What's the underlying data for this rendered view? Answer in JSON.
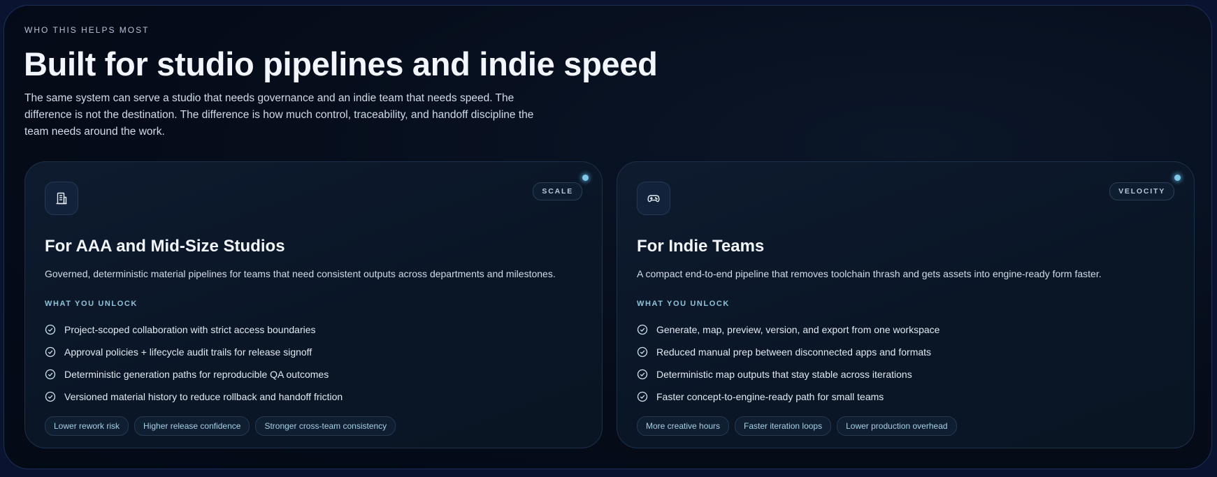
{
  "section": {
    "eyebrow": "WHO THIS HELPS MOST",
    "title": "Built for studio pipelines and indie speed",
    "subtitle": "The same system can serve a studio that needs governance and an indie team that needs speed. The difference is not the destination. The difference is how much control, traceability, and handoff discipline the team needs around the work."
  },
  "cards": [
    {
      "icon": "building-icon",
      "badge": "SCALE",
      "title": "For AAA and Mid-Size Studios",
      "description": "Governed, deterministic material pipelines for teams that need consistent outputs across departments and milestones.",
      "unlock_label": "WHAT YOU UNLOCK",
      "items": [
        "Project-scoped collaboration with strict access boundaries",
        "Approval policies + lifecycle audit trails for release signoff",
        "Deterministic generation paths for reproducible QA outcomes",
        "Versioned material history to reduce rollback and handoff friction"
      ],
      "chips": [
        "Lower rework risk",
        "Higher release confidence",
        "Stronger cross-team consistency"
      ]
    },
    {
      "icon": "gamepad-icon",
      "badge": "VELOCITY",
      "title": "For Indie Teams",
      "description": "A compact end-to-end pipeline that removes toolchain thrash and gets assets into engine-ready form faster.",
      "unlock_label": "WHAT YOU UNLOCK",
      "items": [
        "Generate, map, preview, version, and export from one workspace",
        "Reduced manual prep between disconnected apps and formats",
        "Deterministic map outputs that stay stable across iterations",
        "Faster concept-to-engine-ready path for small teams"
      ],
      "chips": [
        "More creative hours",
        "Faster iteration loops",
        "Lower production overhead"
      ]
    }
  ],
  "colors": {
    "background": "#040a16",
    "accent": "#8fc3d9",
    "indicator": "#7fc8ea"
  }
}
